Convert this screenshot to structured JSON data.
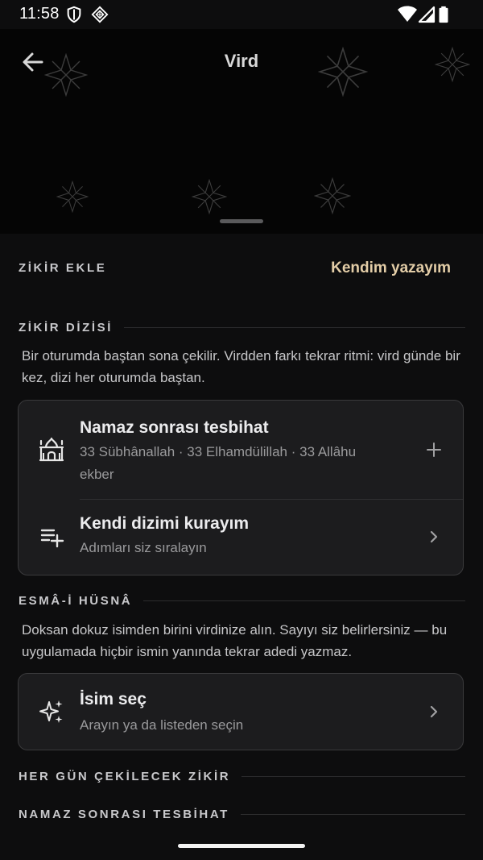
{
  "status": {
    "time": "11:58"
  },
  "header": {
    "title": "Vird"
  },
  "add": {
    "label": "ZİKİR EKLE",
    "write_own": "Kendim yazayım"
  },
  "series": {
    "label": "ZİKİR DİZİSİ",
    "description": "Bir oturumda baştan sona çekilir. Virdden farkı tekrar ritmi: vird günde bir kez, dizi her oturumda baştan.",
    "items": [
      {
        "title": "Namaz sonrası tesbihat",
        "subtitle": "33 Sübhânallah · 33 Elhamdülillah · 33 Allâhu ekber",
        "icon": "mosque-icon",
        "action": "plus-icon"
      },
      {
        "title": "Kendi dizimi kurayım",
        "subtitle": "Adımları siz sıralayın",
        "icon": "playlist-add-icon",
        "action": "chevron-right-icon"
      }
    ]
  },
  "esma": {
    "label": "ESMÂ-İ HÜSNÂ",
    "description": "Doksan dokuz isimden birini virdinize alın. Sayıyı siz belirlersiniz — bu uygulamada hiçbir ismin yanında tekrar adedi yazmaz.",
    "items": [
      {
        "title": "İsim seç",
        "subtitle": "Arayın ya da listeden seçin",
        "icon": "sparkles-icon",
        "action": "chevron-right-icon"
      }
    ]
  },
  "daily": {
    "label": "HER GÜN ÇEKİLECEK ZİKİR"
  },
  "after_prayer": {
    "label": "NAMAZ SONRASI TESBİHAT"
  }
}
